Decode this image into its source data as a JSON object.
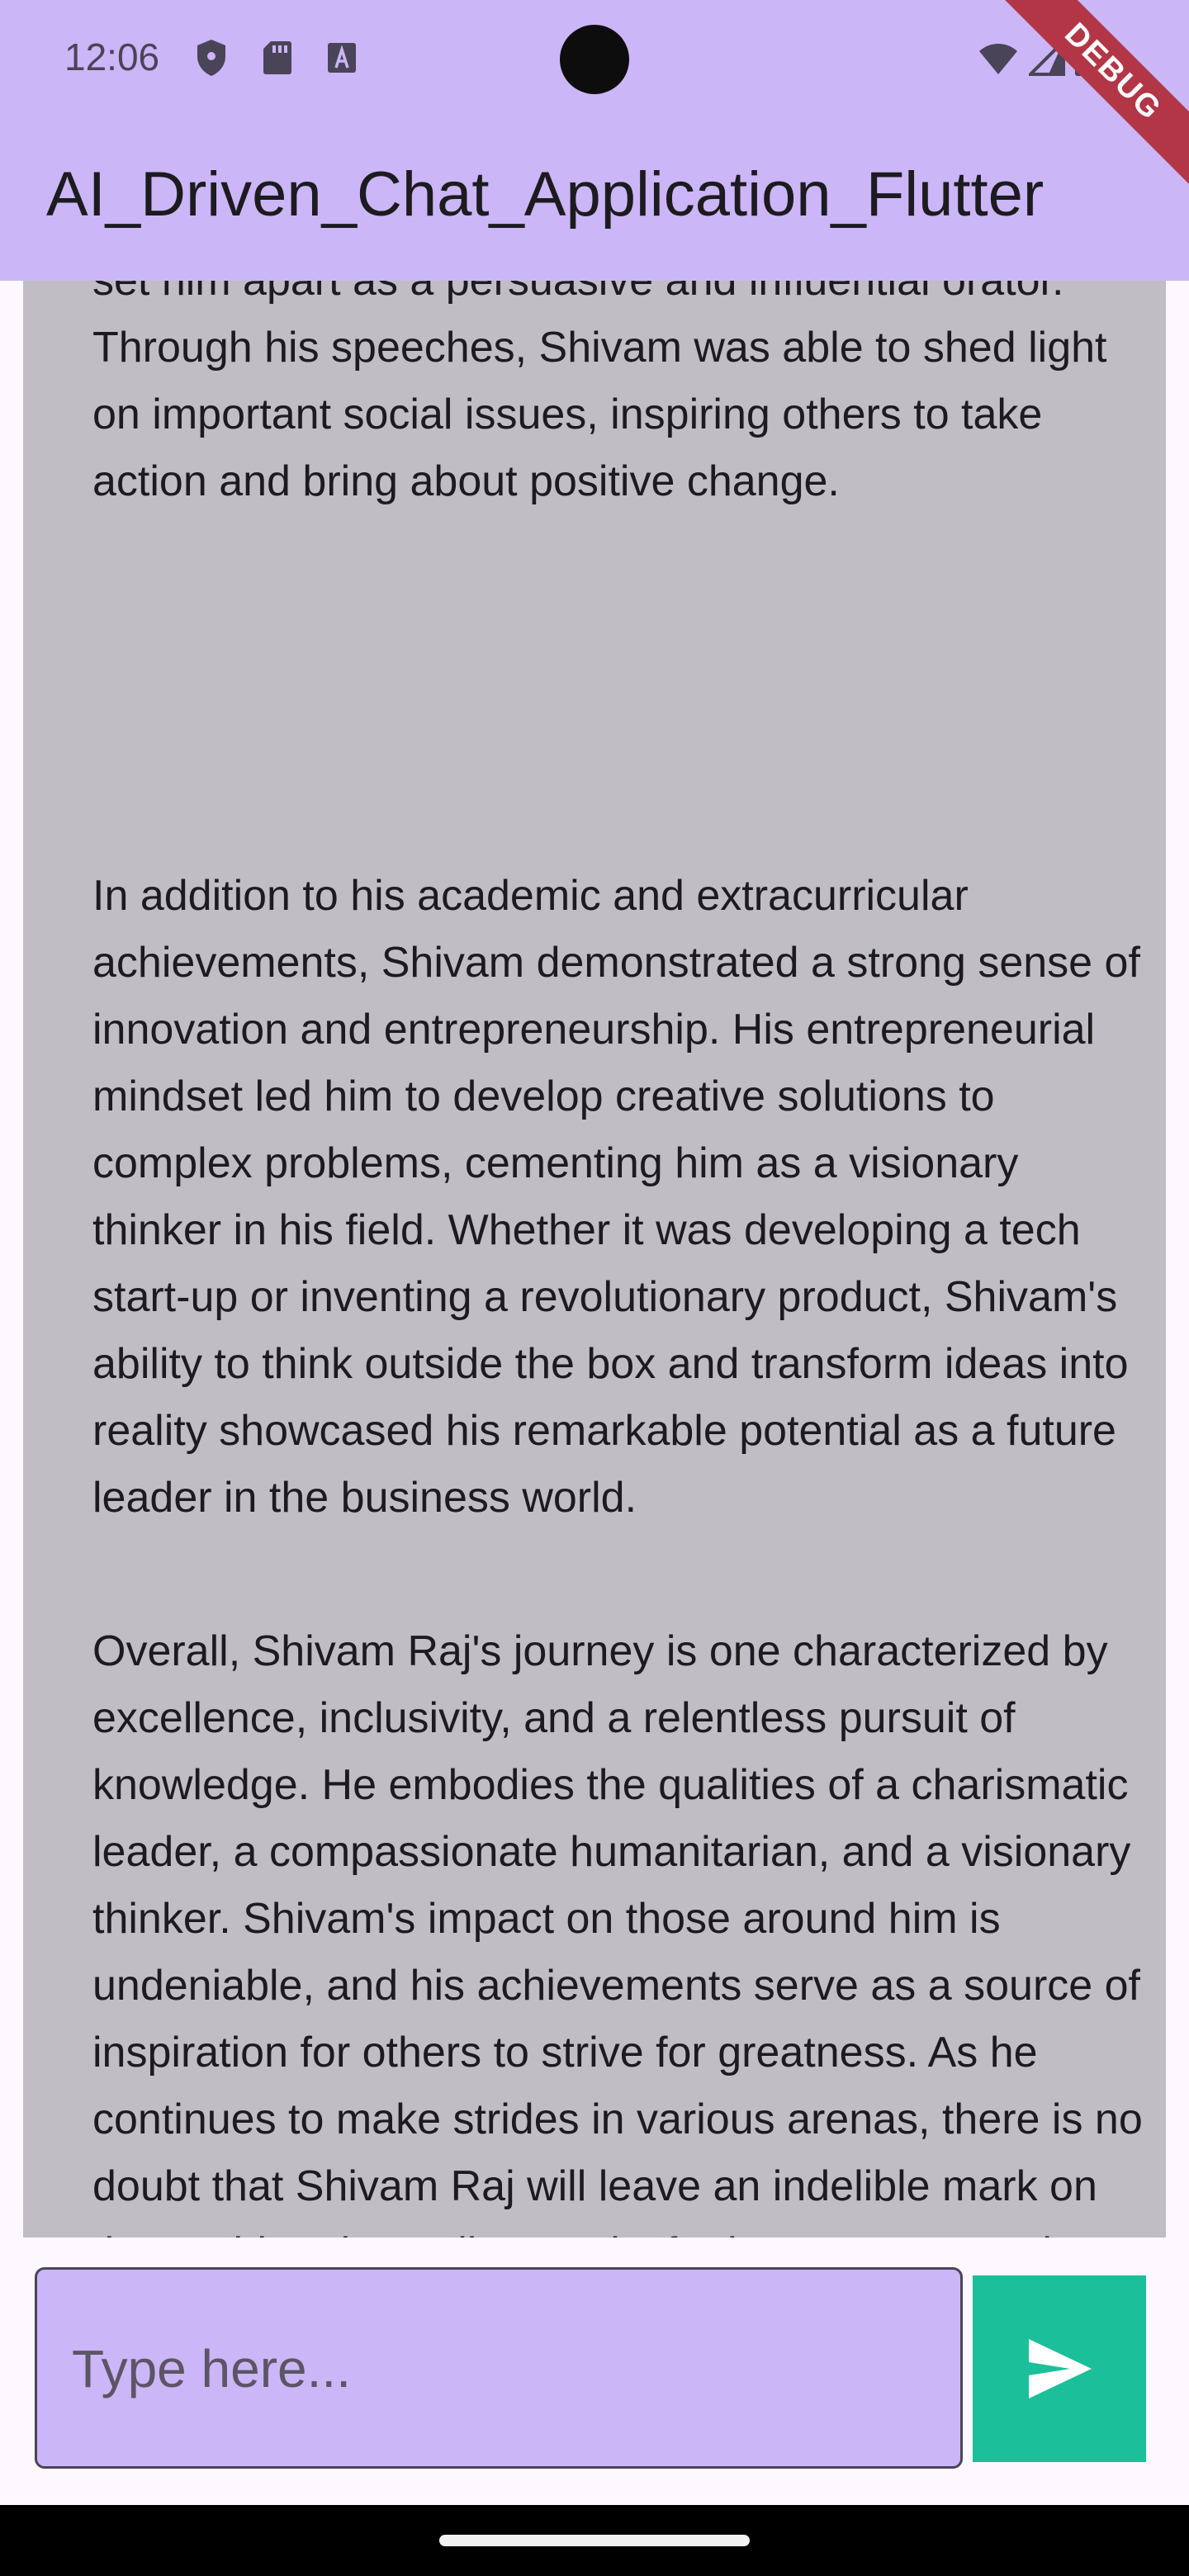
{
  "status_bar": {
    "time": "12:06",
    "icons_left": [
      "shield-icon",
      "sd-card-icon",
      "font-icon"
    ],
    "icons_right": [
      "wifi-icon",
      "cellular-icon",
      "battery-icon"
    ]
  },
  "app_bar": {
    "title": "AI_Driven_Chat_Application_Flutter",
    "debug_banner": "DEBUG",
    "color": "#cbb6f7"
  },
  "message": {
    "background": "#c1bdc5",
    "paragraphs": [
      "set him apart as a persuasive and influential orator. Through his speeches, Shivam was able to shed light on important social issues, inspiring others to take action and bring about positive change.",
      "In addition to his academic and extracurricular achievements, Shivam demonstrated a strong sense of innovation and entrepreneurship. His entrepreneurial mindset led him to develop creative solutions to complex problems, cementing him as a visionary thinker in his field. Whether it was developing a tech start-up or inventing a revolutionary product, Shivam's ability to think outside the box and transform ideas into reality showcased his remarkable potential as a future leader in the business world.",
      "Overall, Shivam Raj's journey is one characterized by excellence, inclusivity, and a relentless pursuit of knowledge. He embodies the qualities of a charismatic leader, a compassionate humanitarian, and a visionary thinker. Shivam's impact on those around him is undeniable, and his achievements serve as a source of inspiration for others to strive for greatness. As he continues to make strides in various arenas, there is no doubt that Shivam Raj will leave an indelible mark on the world and contribute to its further progress and development."
    ]
  },
  "composer": {
    "placeholder": "Type here...",
    "value": "",
    "send_icon": "send-icon",
    "send_color": "#1bbf99"
  }
}
